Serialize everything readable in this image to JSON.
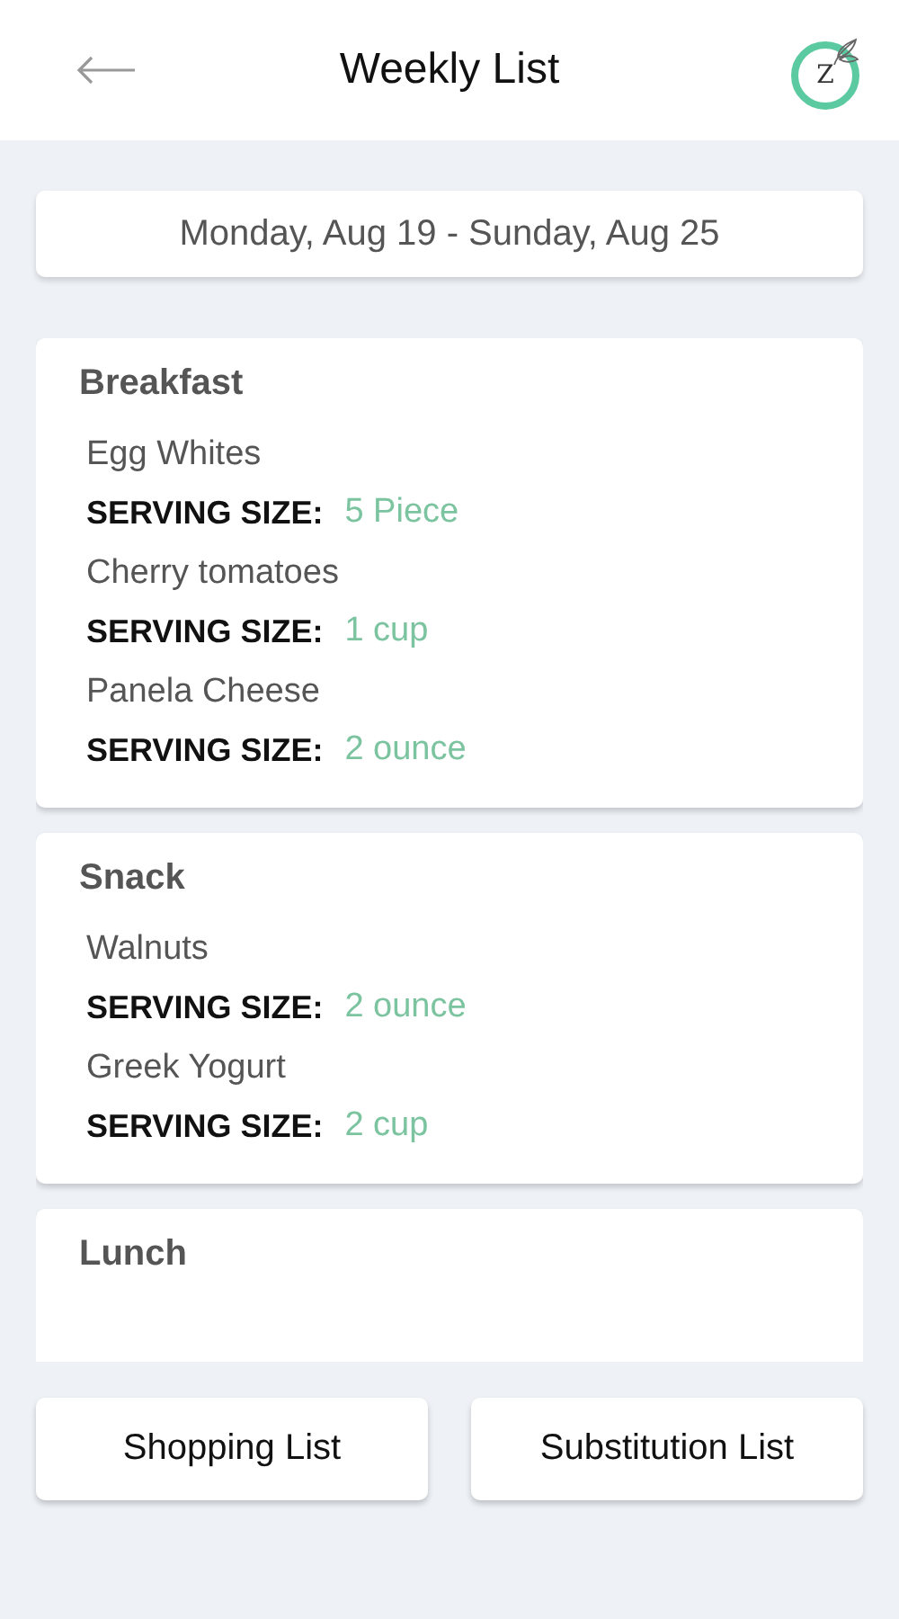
{
  "header": {
    "title": "Weekly List",
    "logo_letter": "Z"
  },
  "date_range": "Monday, Aug 19 - Sunday, Aug 25",
  "meals": [
    {
      "name": "Breakfast",
      "items": [
        {
          "name": "Egg Whites",
          "serving_label": "SERVING SIZE:",
          "serving": "5 Piece"
        },
        {
          "name": "Cherry tomatoes",
          "serving_label": "SERVING SIZE:",
          "serving": "1 cup"
        },
        {
          "name": "Panela Cheese",
          "serving_label": "SERVING SIZE:",
          "serving": "2 ounce"
        }
      ]
    },
    {
      "name": "Snack",
      "items": [
        {
          "name": "Walnuts",
          "serving_label": "SERVING SIZE:",
          "serving": "2 ounce"
        },
        {
          "name": "Greek Yogurt",
          "serving_label": "SERVING SIZE:",
          "serving": "2 cup"
        }
      ]
    },
    {
      "name": "Lunch"
    }
  ],
  "buttons": [
    "Shopping List",
    "Substitution List"
  ]
}
